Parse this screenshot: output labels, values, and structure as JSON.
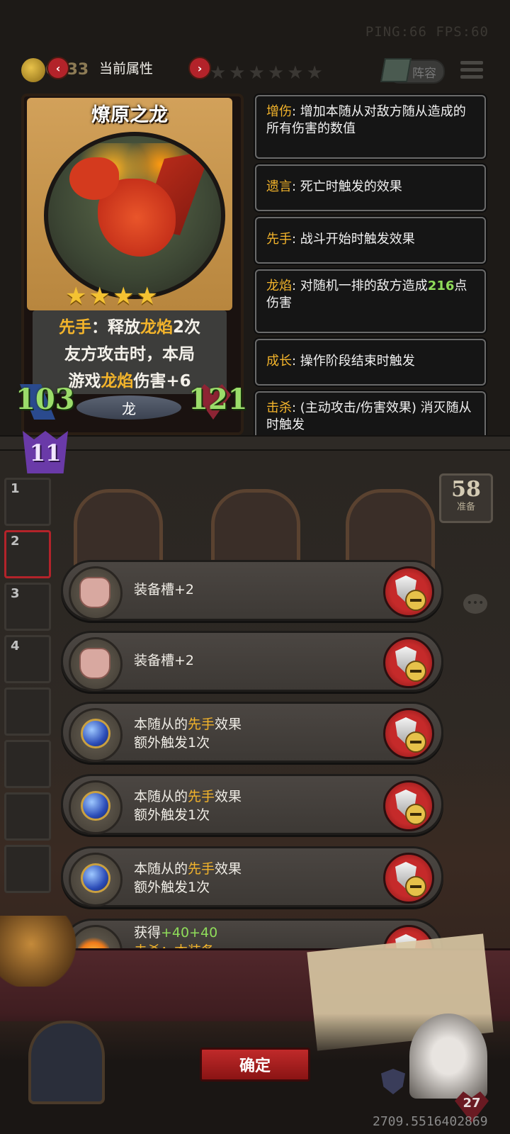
{
  "status": {
    "ping_fps": "PING:66   FPS:60"
  },
  "header": {
    "coins": "6433",
    "title": "当前属性",
    "prev": "‹",
    "next": "›",
    "stars": "★★★★★★",
    "lineup_label": "阵容"
  },
  "card": {
    "name": "燎原之龙",
    "stars": "★★★★",
    "desc_lines": [
      {
        "k": "先手",
        "t1": "：释放",
        "k2": "龙焰",
        "t2": "2次"
      },
      {
        "t": "友方攻击时，本局"
      },
      {
        "t1": "游戏",
        "k": "龙焰",
        "t2": "伤害+6"
      }
    ],
    "attack": "103",
    "health": "121",
    "tribe": "龙"
  },
  "keywords": [
    {
      "k": "增伤",
      "t": ": 增加本随从对敌方随从造成的所有伤害的数值"
    },
    {
      "k": "遗言",
      "t": ": 死亡时触发的效果"
    },
    {
      "k": "先手",
      "t": ": 战斗开始时触发效果"
    },
    {
      "k": "龙焰",
      "t": ": 对随机一排的敌方造成",
      "g": "216",
      "t2": "点伤害"
    },
    {
      "k": "成长",
      "t": ": 操作阶段结束时触发"
    },
    {
      "k": "击杀",
      "t": ": (主动攻击/伤害效果) 消灭随从时触发"
    }
  ],
  "level": "11",
  "side_slots": [
    "1",
    "2",
    "3",
    "4"
  ],
  "prep": {
    "count": "58",
    "label": "准备"
  },
  "equipment": [
    {
      "icon": "bag-icon",
      "line1": "装备槽+2",
      "line2": ""
    },
    {
      "icon": "bag-icon",
      "line1": "装备槽+2",
      "line2": ""
    },
    {
      "icon": "orb-icon",
      "pre": "本随从的",
      "k": "先手",
      "post": "效果",
      "line2": "额外触发1次"
    },
    {
      "icon": "orb-icon",
      "pre": "本随从的",
      "k": "先手",
      "post": "效果",
      "line2": "额外触发1次"
    },
    {
      "icon": "orb-icon",
      "pre": "本随从的",
      "k": "先手",
      "post": "效果",
      "line2": "额外触发1次"
    },
    {
      "icon": "flame-icon",
      "pre": "获得",
      "g": "+40+40",
      "line2": "击杀：本装备"
    }
  ],
  "confirm_label": "确定",
  "player_hp": "27",
  "coord": "2709.5516402869",
  "colors": {
    "keyword": "#f3b42b",
    "green": "#8fdc5a",
    "red_button": "#c02a2a"
  }
}
